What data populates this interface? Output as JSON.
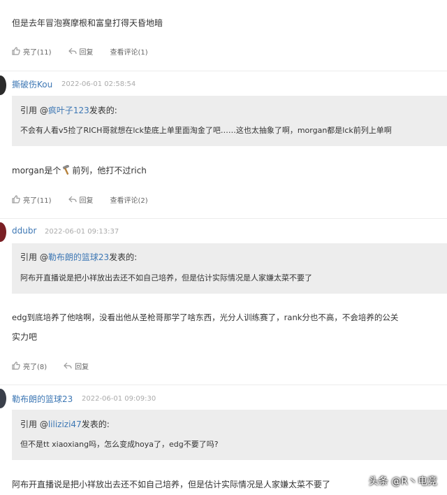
{
  "comment0": {
    "text": "但是去年冒泡赛摩根和富皇打得天昏地暗",
    "like": "亮了(11)",
    "reply": "回复",
    "view": "查看评论(1)"
  },
  "comment1": {
    "user": "撕破伤Kou",
    "time": "2022-06-01 02:58:54",
    "quote_prefix": "引用 @",
    "quote_user": "疯叶子123",
    "quote_suffix": "发表的:",
    "quote_text": "不会有人看v5捡了RICH哥就想在lck垫底上单里面淘金了吧……这也太抽象了啊，morgan都是lck前列上单啊",
    "text_before": "morgan是个",
    "text_after": "前列，他打不过rich",
    "like": "亮了(11)",
    "reply": "回复",
    "view": "查看评论(2)"
  },
  "comment2": {
    "user": "ddubr",
    "time": "2022-06-01 09:13:37",
    "quote_prefix": "引用 @",
    "quote_user": "勒布朗的篮球23",
    "quote_suffix": "发表的:",
    "quote_text": "阿布开直播说是把小祥放出去还不如自己培养，但是估计实际情况是人家嫌太菜不要了",
    "text_line1": "edg到底培养了他啥啊，没看出他从圣枪哥那学了啥东西，光分人训练赛了，rank分也不高，不会培养的公关",
    "text_line2": "实力吧",
    "like": "亮了(8)",
    "reply": "回复"
  },
  "comment3": {
    "user": "勒布朗的篮球23",
    "time": "2022-06-01 09:09:30",
    "quote_prefix": "引用 @",
    "quote_user": "lilizizi47",
    "quote_suffix": "发表的:",
    "quote_text": "但不是tt xiaoxiang吗，怎么变成hoya了，edg不要了吗?",
    "text": "阿布开直播说是把小祥放出去还不如自己培养，但是估计实际情况是人家嫌太菜不要了"
  },
  "watermark": "头条 @R丶电竞"
}
